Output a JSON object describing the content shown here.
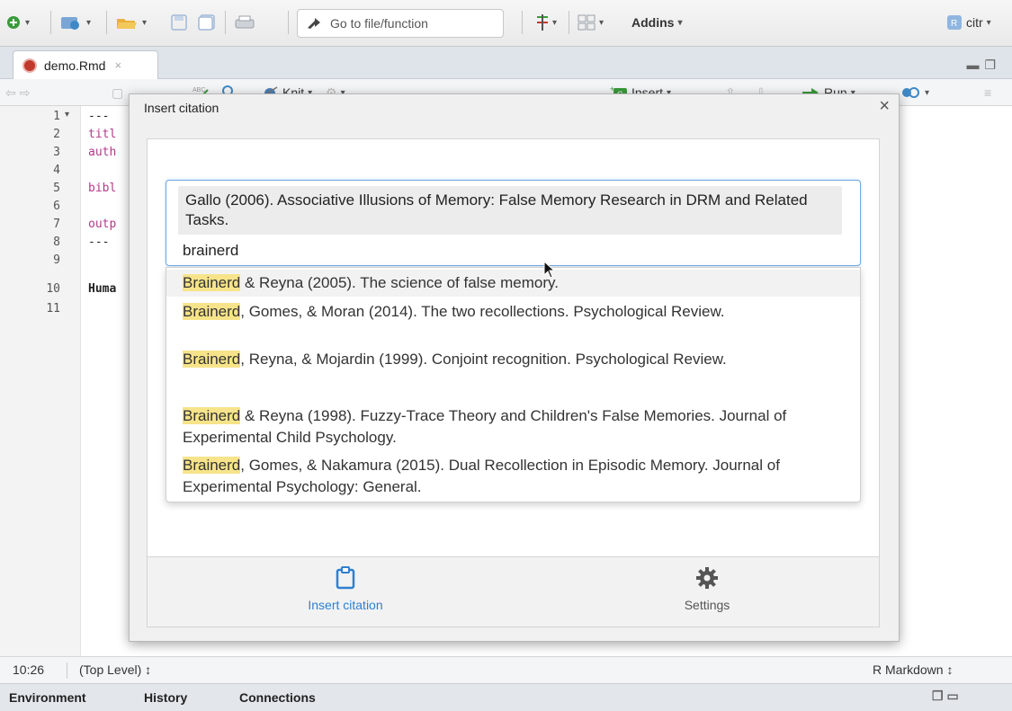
{
  "toolbar": {
    "goto_placeholder": "Go to file/function",
    "addins_label": "Addins",
    "project_label": "citr"
  },
  "editor": {
    "tab_name": "demo.Rmd",
    "knit_label": "Knit",
    "insert_label": "Insert",
    "run_label": "Run",
    "line_numbers": [
      "1",
      "2",
      "3",
      "4",
      "5",
      "6",
      "7",
      "8",
      "9",
      "10",
      "11"
    ],
    "code_lines": {
      "l1": "---",
      "l2": "titl",
      "l3": "auth",
      "l5": "bibl",
      "l7": "outp",
      "l8": "---",
      "l10": "Huma"
    }
  },
  "status": {
    "cursor": "10:26",
    "scope": "(Top Level) ↕",
    "mode": "R Markdown ↕"
  },
  "bottom_tabs": [
    "Environment",
    "History",
    "Connections"
  ],
  "dialog": {
    "title": "Insert citation",
    "selected_citation": "Gallo (2006). Associative Illusions of Memory: False Memory Research in DRM and Related Tasks.",
    "query": "brainerd",
    "suggestions": [
      {
        "match": "Brainerd",
        "rest": " & Reyna (2005). The science of false memory."
      },
      {
        "match": "Brainerd",
        "rest": ", Gomes, & Moran (2014). The two recollections. Psychological Review."
      },
      {
        "match": "Brainerd",
        "rest": ", Reyna, & Mojardin (1999). Conjoint recognition. Psychological Review."
      },
      {
        "match": "Brainerd",
        "rest": " & Reyna (1998). Fuzzy-Trace Theory and Children's False Memories. Journal of Experimental Child Psychology."
      },
      {
        "match": "Brainerd",
        "rest": ", Gomes, & Nakamura (2015). Dual Recollection in Episodic Memory. Journal of Experimental Psychology: General."
      }
    ],
    "footer": {
      "insert_label": "Insert citation",
      "settings_label": "Settings"
    }
  },
  "colors": {
    "accent_blue": "#2f7fd0",
    "highlight": "#f7e48a",
    "keyword": "#b23a87"
  }
}
